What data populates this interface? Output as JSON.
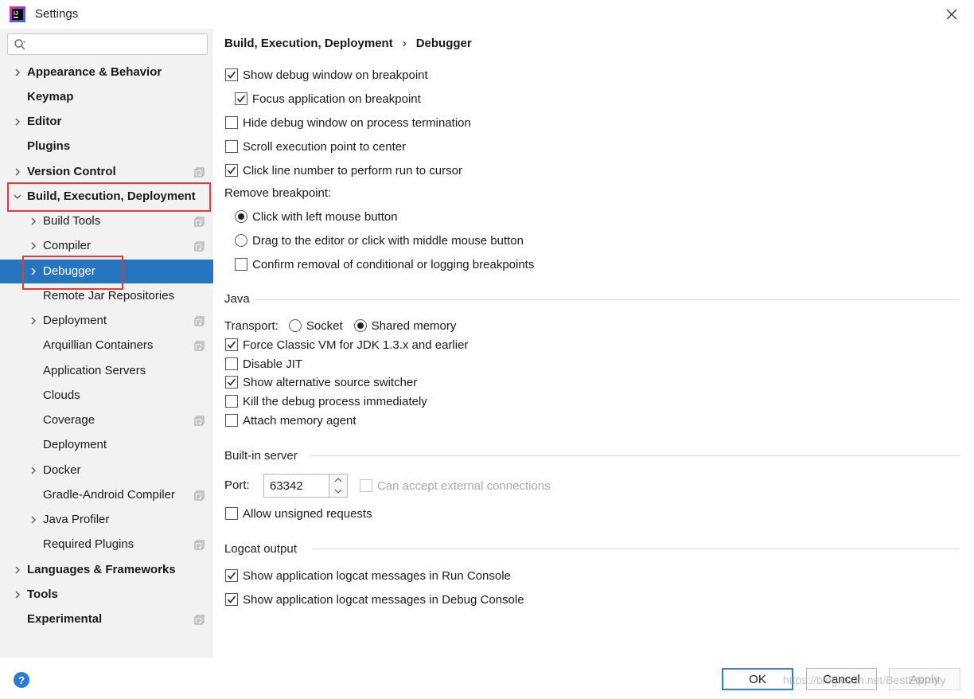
{
  "window": {
    "title": "Settings"
  },
  "search": {
    "placeholder": ""
  },
  "sidebar": {
    "items": [
      {
        "label": "Appearance & Behavior"
      },
      {
        "label": "Keymap"
      },
      {
        "label": "Editor"
      },
      {
        "label": "Plugins"
      },
      {
        "label": "Version Control"
      },
      {
        "label": "Build, Execution, Deployment"
      },
      {
        "label": "Build Tools"
      },
      {
        "label": "Compiler"
      },
      {
        "label": "Debugger"
      },
      {
        "label": "Remote Jar Repositories"
      },
      {
        "label": "Deployment"
      },
      {
        "label": "Arquillian Containers"
      },
      {
        "label": "Application Servers"
      },
      {
        "label": "Clouds"
      },
      {
        "label": "Coverage"
      },
      {
        "label": "Deployment"
      },
      {
        "label": "Docker"
      },
      {
        "label": "Gradle-Android Compiler"
      },
      {
        "label": "Java Profiler"
      },
      {
        "label": "Required Plugins"
      },
      {
        "label": "Languages & Frameworks"
      },
      {
        "label": "Tools"
      },
      {
        "label": "Experimental"
      }
    ]
  },
  "breadcrumb": {
    "parent": "Build, Execution, Deployment",
    "separator": "›",
    "current": "Debugger"
  },
  "general": {
    "show_debug_window": {
      "label": "Show debug window on breakpoint",
      "checked": true
    },
    "focus_application": {
      "label": "Focus application on breakpoint",
      "checked": true
    },
    "hide_debug_window": {
      "label": "Hide debug window on process termination",
      "checked": false
    },
    "scroll_execution": {
      "label": "Scroll execution point to center",
      "checked": false
    },
    "click_line_number": {
      "label": "Click line number to perform run to cursor",
      "checked": true
    },
    "remove_breakpoint_label": "Remove breakpoint:",
    "remove_left_click": {
      "label": "Click with left mouse button",
      "selected": true
    },
    "remove_drag": {
      "label": "Drag to the editor or click with middle mouse button",
      "selected": false
    },
    "confirm_removal": {
      "label": "Confirm removal of conditional or logging breakpoints",
      "checked": false
    }
  },
  "java": {
    "section_title": "Java",
    "transport_label": "Transport:",
    "transport_socket": "Socket",
    "transport_shared_memory": "Shared memory",
    "force_classic_vm": {
      "label": "Force Classic VM for JDK 1.3.x and earlier",
      "checked": true
    },
    "disable_jit": {
      "label": "Disable JIT",
      "checked": false
    },
    "show_alt_source": {
      "label": "Show alternative source switcher",
      "checked": true
    },
    "kill_debug_process": {
      "label": "Kill the debug process immediately",
      "checked": false
    },
    "attach_memory_agent": {
      "label": "Attach memory agent",
      "checked": false
    }
  },
  "builtin_server": {
    "section_title": "Built-in server",
    "port_label": "Port:",
    "port_value": "63342",
    "accept_external": "Can accept external connections",
    "allow_unsigned": "Allow unsigned requests"
  },
  "logcat": {
    "section_title": "Logcat output",
    "run_console": {
      "label": "Show application logcat messages in Run Console",
      "checked": true
    },
    "debug_console": {
      "label": "Show application logcat messages in Debug Console",
      "checked": true
    }
  },
  "buttons": {
    "help": "?",
    "ok": "OK",
    "cancel": "Cancel",
    "apply": "Apply"
  },
  "watermark": "https://blog.csdn.net/BestEternity",
  "colors": {
    "selection": "#2675bf",
    "highlight_box": "#e33b3b",
    "ok_border": "#2f7fd1"
  }
}
